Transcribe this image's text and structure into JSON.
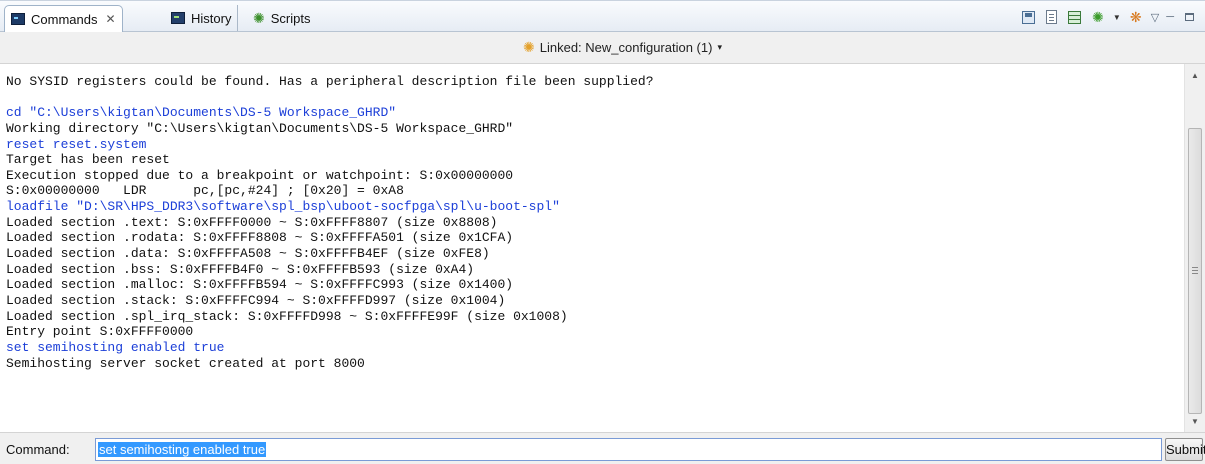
{
  "tabs": {
    "commands": "Commands",
    "commands_close": "✕",
    "history": "History",
    "scripts": "Scripts"
  },
  "linked": {
    "label": "Linked: New_configuration (1)",
    "arrow": "▾"
  },
  "console": {
    "lines": [
      {
        "text": "No SYSID registers could be found. Has a peripheral description file been supplied?",
        "kind": "output"
      },
      {
        "text": "",
        "kind": "blank"
      },
      {
        "text": "cd \"C:\\Users\\kigtan\\Documents\\DS-5 Workspace_GHRD\"",
        "kind": "command"
      },
      {
        "text": "Working directory \"C:\\Users\\kigtan\\Documents\\DS-5 Workspace_GHRD\"",
        "kind": "output"
      },
      {
        "text": "reset reset.system",
        "kind": "command"
      },
      {
        "text": "Target has been reset",
        "kind": "output"
      },
      {
        "text": "Execution stopped due to a breakpoint or watchpoint: S:0x00000000",
        "kind": "output"
      },
      {
        "text": "S:0x00000000   LDR      pc,[pc,#24] ; [0x20] = 0xA8",
        "kind": "output"
      },
      {
        "text": "loadfile \"D:\\SR\\HPS_DDR3\\software\\spl_bsp\\uboot-socfpga\\spl\\u-boot-spl\"",
        "kind": "command"
      },
      {
        "text": "Loaded section .text: S:0xFFFF0000 ~ S:0xFFFF8807 (size 0x8808)",
        "kind": "output"
      },
      {
        "text": "Loaded section .rodata: S:0xFFFF8808 ~ S:0xFFFFA501 (size 0x1CFA)",
        "kind": "output"
      },
      {
        "text": "Loaded section .data: S:0xFFFFA508 ~ S:0xFFFFB4EF (size 0xFE8)",
        "kind": "output"
      },
      {
        "text": "Loaded section .bss: S:0xFFFFB4F0 ~ S:0xFFFFB593 (size 0xA4)",
        "kind": "output"
      },
      {
        "text": "Loaded section .malloc: S:0xFFFFB594 ~ S:0xFFFFC993 (size 0x1400)",
        "kind": "output"
      },
      {
        "text": "Loaded section .stack: S:0xFFFFC994 ~ S:0xFFFFD997 (size 0x1004)",
        "kind": "output"
      },
      {
        "text": "Loaded section .spl_irq_stack: S:0xFFFFD998 ~ S:0xFFFFE99F (size 0x1008)",
        "kind": "output"
      },
      {
        "text": "Entry point S:0xFFFF0000",
        "kind": "output"
      },
      {
        "text": "set semihosting enabled true",
        "kind": "command"
      },
      {
        "text": "Semihosting server socket created at port 8000",
        "kind": "output"
      }
    ]
  },
  "command_bar": {
    "label": "Command:",
    "value": "set semihosting enabled true",
    "submit": "Submit"
  },
  "colors": {
    "command_text": "#1c3fd8",
    "output_text": "#111111",
    "selection": "#3399ff"
  }
}
